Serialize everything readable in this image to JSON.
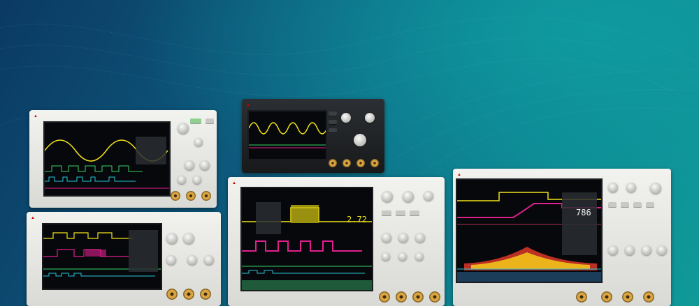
{
  "scene": "product-banner",
  "colors": {
    "background_left": "#0b3a63",
    "background_right": "#0f9a98",
    "trace_yellow": "#f2e21b",
    "trace_magenta": "#e0208e",
    "trace_green": "#39d26a",
    "trace_cyan": "#26c6da",
    "brand_red": "#cc0000"
  },
  "icons": [
    "wave-pattern-decoration",
    "oscilloscope-device"
  ],
  "readouts": {
    "scope3_value": "2.72",
    "scope4_value": "786"
  }
}
